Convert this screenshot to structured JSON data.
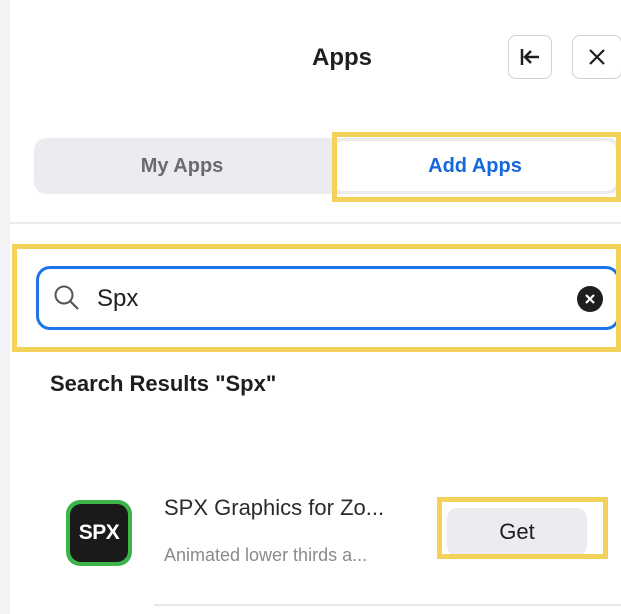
{
  "header": {
    "title": "Apps",
    "collapse_icon": "collapse-to-left-icon",
    "close_icon": "close-icon"
  },
  "tabs": [
    {
      "label": "My Apps",
      "selected": false
    },
    {
      "label": "Add Apps",
      "selected": true
    }
  ],
  "search": {
    "value": "Spx",
    "icon": "search-icon",
    "clear_icon": "clear-icon"
  },
  "results": {
    "title": "Search Results \"Spx\"",
    "items": [
      {
        "logo_text": "SPX",
        "name": "SPX Graphics for Zo...",
        "description": "Animated lower thirds a...",
        "action_label": "Get"
      }
    ]
  },
  "colors": {
    "accent": "#1767dc",
    "highlight": "#f3d25a",
    "logo_green": "#3bb54a"
  }
}
